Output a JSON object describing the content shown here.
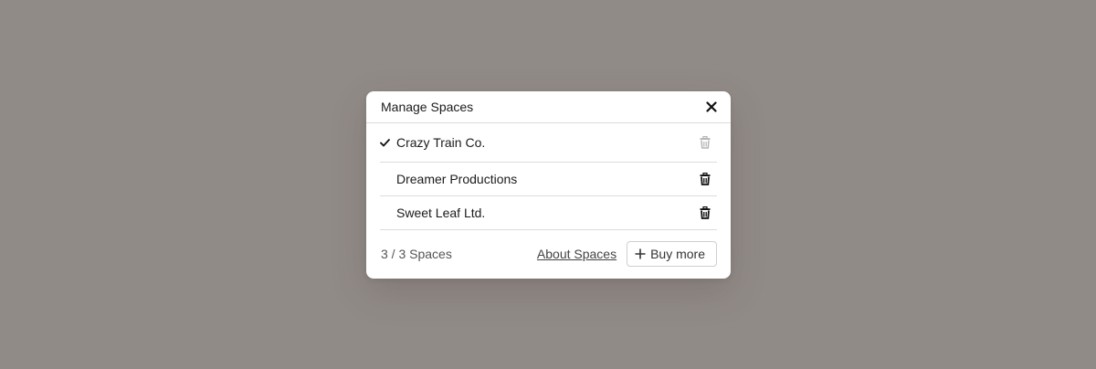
{
  "dialog": {
    "title": "Manage Spaces",
    "close_icon": "close-icon"
  },
  "spaces": [
    {
      "name": "Crazy Train Co.",
      "active": true,
      "delete_enabled": false
    },
    {
      "name": "Dreamer Productions",
      "active": false,
      "delete_enabled": true
    },
    {
      "name": "Sweet Leaf Ltd.",
      "active": false,
      "delete_enabled": true
    }
  ],
  "footer": {
    "count_label": "3 / 3 Spaces",
    "about_link": "About Spaces",
    "buy_label": "Buy more"
  },
  "colors": {
    "backdrop": "#918b87",
    "trash_disabled": "#b5b5b5",
    "trash_enabled": "#111111"
  }
}
